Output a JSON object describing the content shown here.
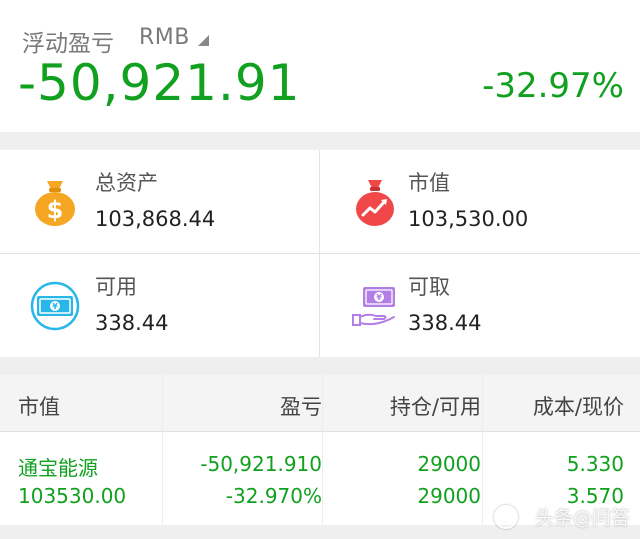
{
  "header": {
    "label": "浮动盈亏",
    "currency": "RMB",
    "pnl_value": "-50,921.91",
    "pnl_pct": "-32.97%"
  },
  "cards": [
    {
      "label": "总资产",
      "value": "103,868.44",
      "icon": "money-bag-dollar-icon"
    },
    {
      "label": "市值",
      "value": "103,530.00",
      "icon": "money-bag-chart-icon"
    },
    {
      "label": "可用",
      "value": "338.44",
      "icon": "banknote-icon"
    },
    {
      "label": "可取",
      "value": "338.44",
      "icon": "hand-withdraw-icon"
    }
  ],
  "table": {
    "headers": [
      "市值",
      "盈亏",
      "持仓/可用",
      "成本/现价"
    ],
    "rows": [
      {
        "name": "通宝能源",
        "market_value": "103530.00",
        "pnl": "-50,921.910",
        "pnl_pct": "-32.970%",
        "position": "29000",
        "available": "29000",
        "cost": "5.330",
        "price": "3.570"
      }
    ]
  },
  "watermark": "头条@问答",
  "colors": {
    "loss_green": "#11a01f",
    "gold": "#f5a623",
    "red": "#f04848",
    "cyan": "#29b6e8",
    "purple": "#b37ee6"
  }
}
